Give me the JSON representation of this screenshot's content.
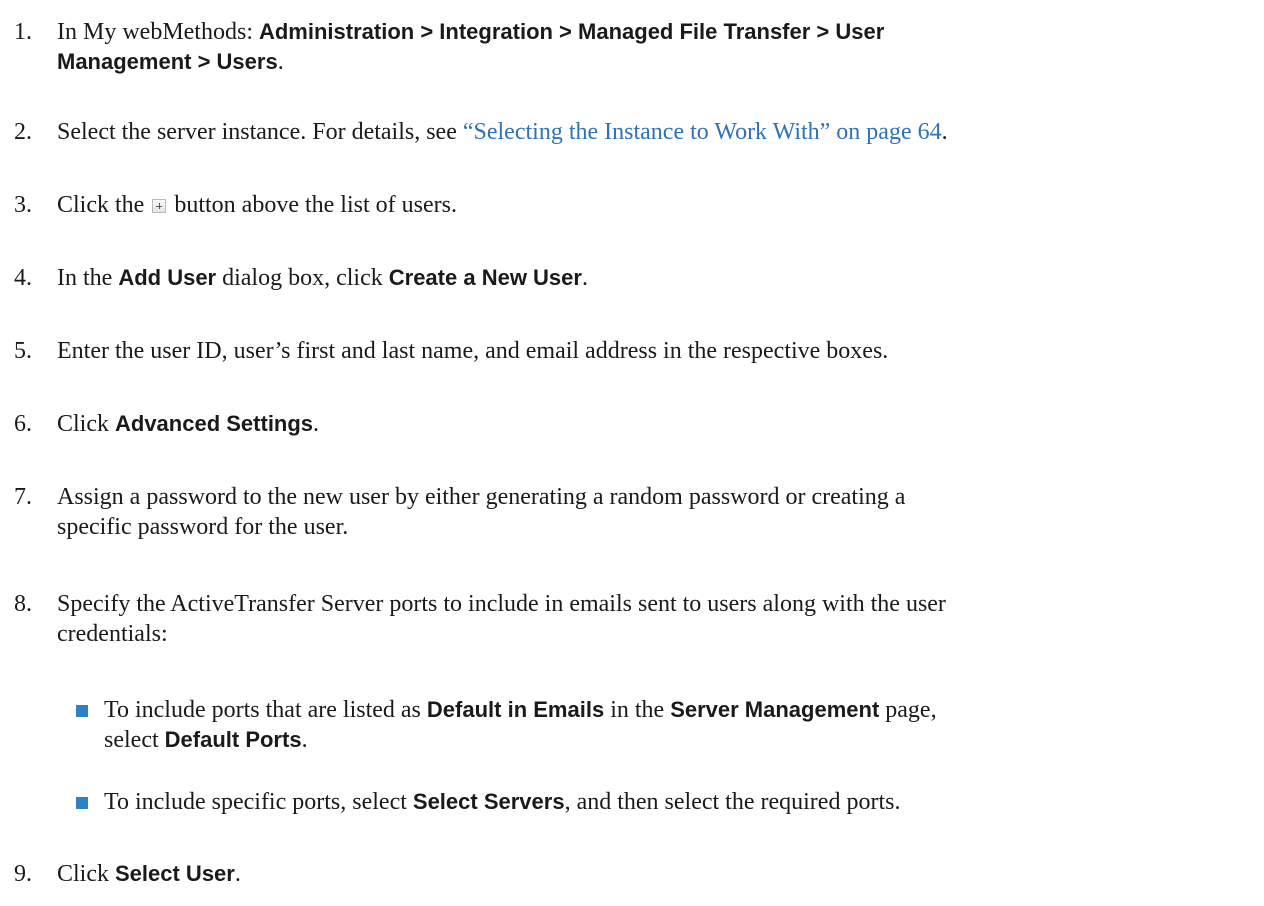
{
  "steps": [
    {
      "num": "1.",
      "pre": "In My webMethods: ",
      "bold": "Administration > Integration > Managed File Transfer > User",
      "bold2": "Management > Users",
      "post": "."
    },
    {
      "num": "2.",
      "pre": "Select the server instance. For details, see ",
      "link": "“Selecting the Instance to Work With” on page 64",
      "post": "."
    },
    {
      "num": "3.",
      "pre": "Click the ",
      "icon": "plus-button-icon",
      "post": " button above the list of users."
    },
    {
      "num": "4.",
      "pre": "In the ",
      "bold": "Add User",
      "mid": " dialog box, click ",
      "bold2": "Create a New User",
      "post": "."
    },
    {
      "num": "5.",
      "text": "Enter the user ID, user’s first and last name, and email address in the respective boxes."
    },
    {
      "num": "6.",
      "pre": "Click ",
      "bold": "Advanced Settings",
      "post": "."
    },
    {
      "num": "7.",
      "line1": "Assign a password to the new user by either generating a random password or creating a",
      "line2": "specific password for the user."
    },
    {
      "num": "8.",
      "line1": "Specify the ActiveTransfer Server ports to include in emails sent to users along with the user",
      "line2": "credentials:",
      "bullets": [
        {
          "pre": "To include ports that are listed as ",
          "bold": "Default in Emails",
          "mid": " in the ",
          "bold2": "Server Management",
          "post": " page,",
          "line2_pre": "select ",
          "line2_bold": "Default Ports",
          "line2_post": "."
        },
        {
          "pre": "To include specific ports, select ",
          "bold": "Select Servers",
          "post": ", and then select the required ports."
        }
      ]
    },
    {
      "num": "9.",
      "pre": "Click ",
      "bold": "Select User",
      "post": "."
    }
  ]
}
